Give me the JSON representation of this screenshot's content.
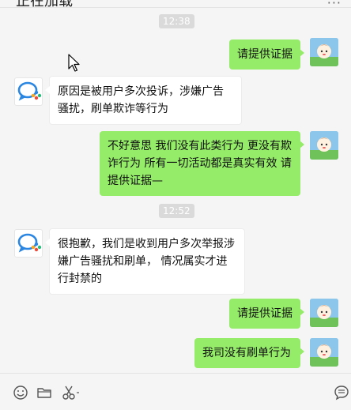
{
  "window": {
    "title": "正在加载"
  },
  "messages": [
    {
      "type": "time",
      "text": "12:38"
    },
    {
      "type": "msg",
      "from": "me",
      "text": "请提供证据"
    },
    {
      "type": "msg",
      "from": "other",
      "text": "原因是被用户多次投诉，涉嫌广告骚扰，刷单欺诈等行为"
    },
    {
      "type": "msg",
      "from": "me",
      "text": "不好意思 我们没有此类行为 更没有欺诈行为 所有一切活动都是真实有效 请提供证据—"
    },
    {
      "type": "time",
      "text": "12:52"
    },
    {
      "type": "msg",
      "from": "other",
      "text": "很抱歉，我们是收到用户多次举报涉嫌广告骚扰和刷单， 情况属实才进行封禁的"
    },
    {
      "type": "msg",
      "from": "me",
      "text": "请提供证据"
    },
    {
      "type": "msg",
      "from": "me",
      "text": "我司没有刷单行为"
    }
  ],
  "icons": {
    "more": "more-icon",
    "emoji": "emoji-icon",
    "folder": "folder-icon",
    "scissors": "scissors-icon",
    "chat_history": "chat-history-icon"
  },
  "colors": {
    "bubble_me": "#95ec69",
    "bubble_other": "#ffffff",
    "background": "#f5f5f5"
  }
}
